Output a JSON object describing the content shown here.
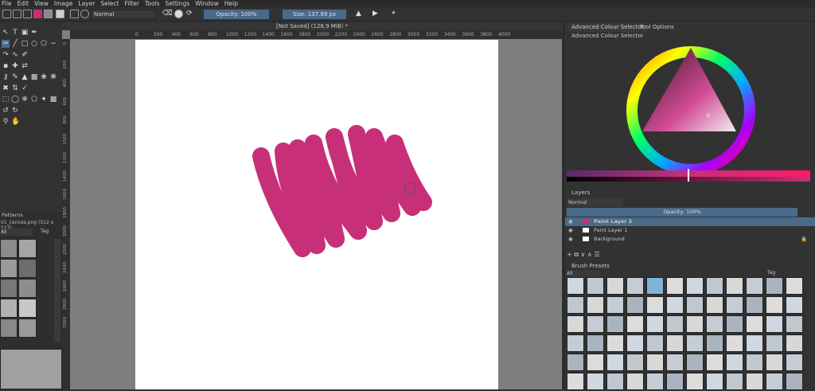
{
  "menu": [
    "File",
    "Edit",
    "View",
    "Image",
    "Layer",
    "Select",
    "Filter",
    "Tools",
    "Settings",
    "Window",
    "Help"
  ],
  "toolbar": {
    "blend_mode": "Normal",
    "opacity_label": "Opacity: 100%",
    "size_label": "Size: 137.99 px"
  },
  "document": {
    "tab_title": "[Not Saved]  (128,9 MiB) *"
  },
  "ruler_h": [
    "0",
    "200",
    "400",
    "600",
    "800",
    "1000",
    "1200",
    "1400",
    "1600",
    "1800",
    "2000",
    "2200",
    "2400",
    "2600",
    "2800",
    "3000",
    "3200",
    "3400",
    "3600",
    "3800",
    "4000"
  ],
  "ruler_v": [
    "0",
    "200",
    "400",
    "600",
    "800",
    "1000",
    "1200",
    "1400",
    "1600",
    "1800",
    "2000",
    "2200",
    "2400",
    "2600",
    "2800",
    "3000"
  ],
  "patterns": {
    "title": "Patterns",
    "file": "01_canvas.png (512 x 512)",
    "filter": "All",
    "tag": "Tag"
  },
  "dock": {
    "tabs": [
      "Advanced Colour Selector",
      "Tool Options"
    ],
    "color_selector_title": "Advanced Colour Selector",
    "accent": "#c73079"
  },
  "layers": {
    "title": "Layers",
    "blend": "Normal",
    "opacity_label": "Opacity:  100%",
    "items": [
      {
        "name": "Paint Layer 2",
        "active": true
      },
      {
        "name": "Paint Layer 1",
        "active": false
      },
      {
        "name": "Background",
        "active": false
      }
    ]
  },
  "brush_presets": {
    "title": "Brush Presets",
    "filter": "All",
    "tag": "Tag"
  }
}
